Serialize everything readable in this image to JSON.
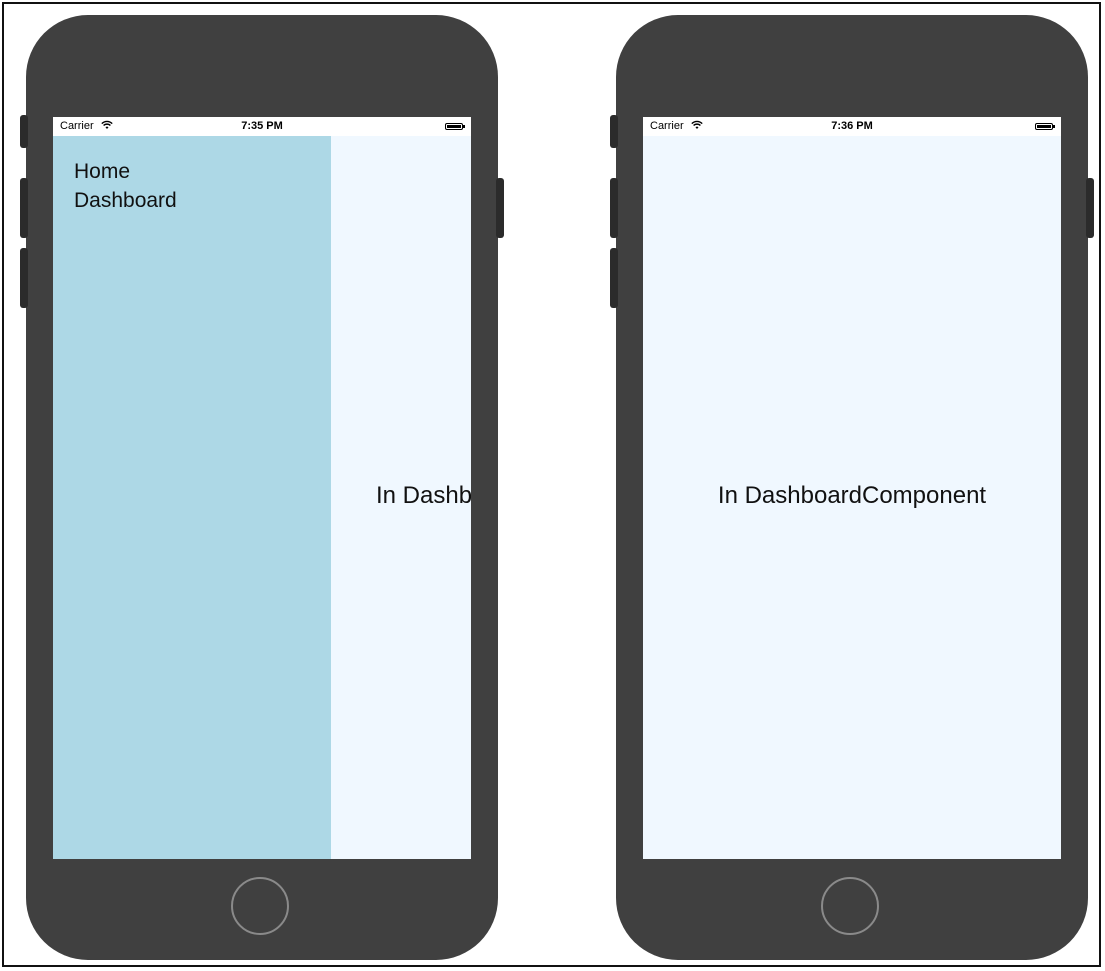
{
  "left_phone": {
    "status": {
      "carrier": "Carrier",
      "wifi_icon": "wifi-icon",
      "time": "7:35 PM"
    },
    "drawer": {
      "items": [
        {
          "label": "Home"
        },
        {
          "label": "Dashboard"
        }
      ]
    },
    "main_text": "In DashboardComponent"
  },
  "right_phone": {
    "status": {
      "carrier": "Carrier",
      "wifi_icon": "wifi-icon",
      "time": "7:36 PM"
    },
    "main_text": "In DashboardComponent"
  },
  "colors": {
    "drawer_bg": "#add8e6",
    "content_bg": "#f0f8ff",
    "phone_body": "#404040"
  }
}
